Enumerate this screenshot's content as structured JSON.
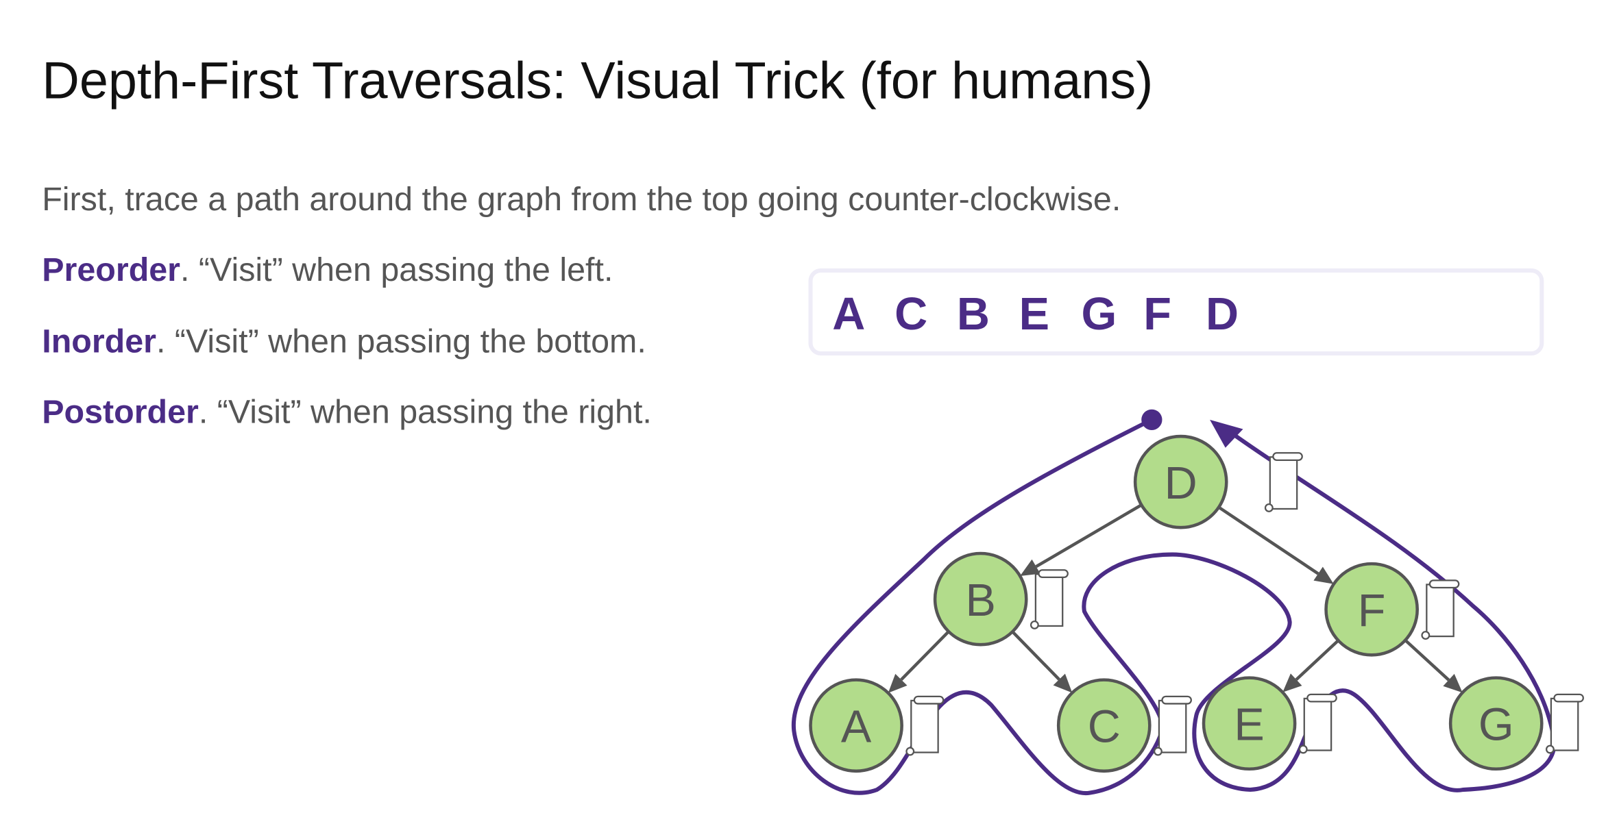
{
  "title": "Depth-First Traversals: Visual Trick (for humans)",
  "intro": "First, trace a path around the graph from the top going counter-clockwise.",
  "rules": [
    {
      "term": "Preorder",
      "rest": ". “Visit” when passing the left."
    },
    {
      "term": "Inorder",
      "rest": ". “Visit” when passing the bottom."
    },
    {
      "term": "Postorder",
      "rest": ". “Visit” when passing the right."
    }
  ],
  "sequence": [
    "A",
    "C",
    "B",
    "E",
    "G",
    "F",
    "D"
  ],
  "nodes": [
    "D",
    "B",
    "F",
    "A",
    "C",
    "E",
    "G"
  ],
  "colors": {
    "accent": "#4b2c86",
    "node_fill": "#b2dc8b",
    "node_stroke": "#555555",
    "text": "#555555",
    "box_border": "#eeecf7"
  },
  "icons": {
    "note": "scroll-icon",
    "start": "start-dot",
    "end": "arrowhead"
  }
}
